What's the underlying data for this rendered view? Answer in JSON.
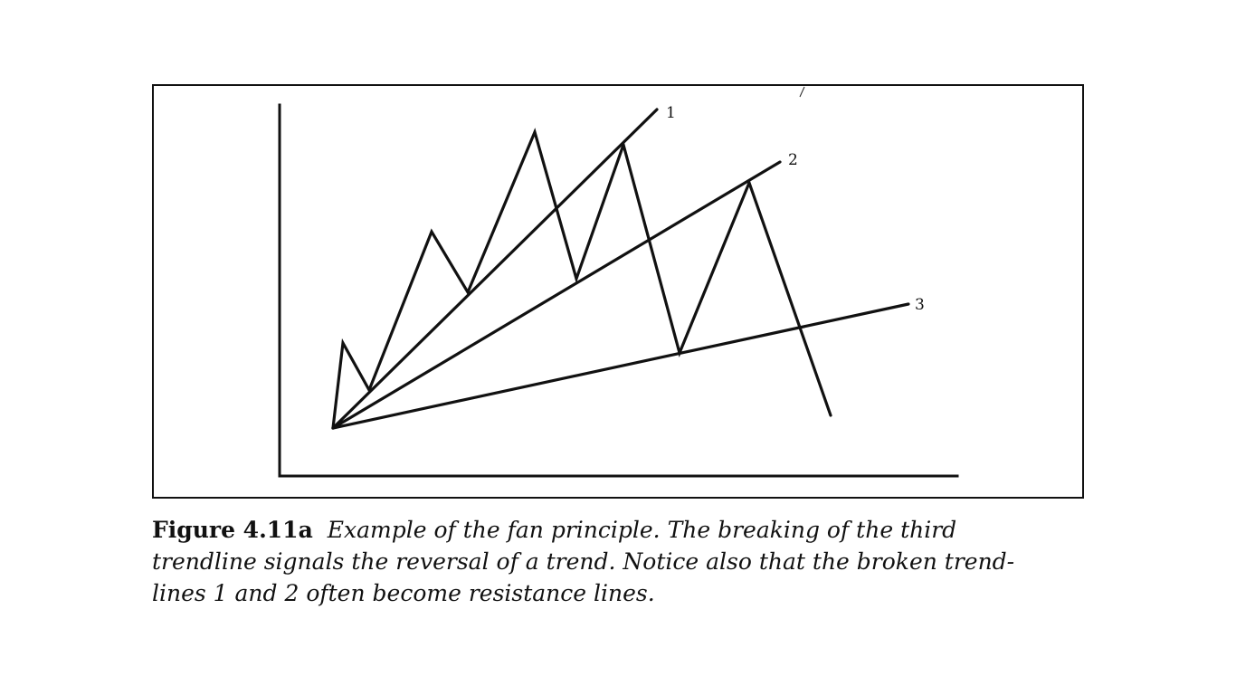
{
  "figure": {
    "number": "Figure 4.11a",
    "caption_lines": [
      "Example of the fan principle. The breaking of the third",
      "trendline signals the reversal of a trend. Notice also that the broken trend-",
      "lines 1 and 2 often become resistance lines."
    ]
  },
  "diagram": {
    "trendline_labels": [
      "1",
      "2",
      "3"
    ],
    "trendlines": [
      {
        "label": "1",
        "touches": "rising lows of first advance"
      },
      {
        "label": "2",
        "touches": "reaction low after peak"
      },
      {
        "label": "3",
        "touches": "final low, broken by last decline"
      }
    ],
    "price_path_description_visible": false
  }
}
